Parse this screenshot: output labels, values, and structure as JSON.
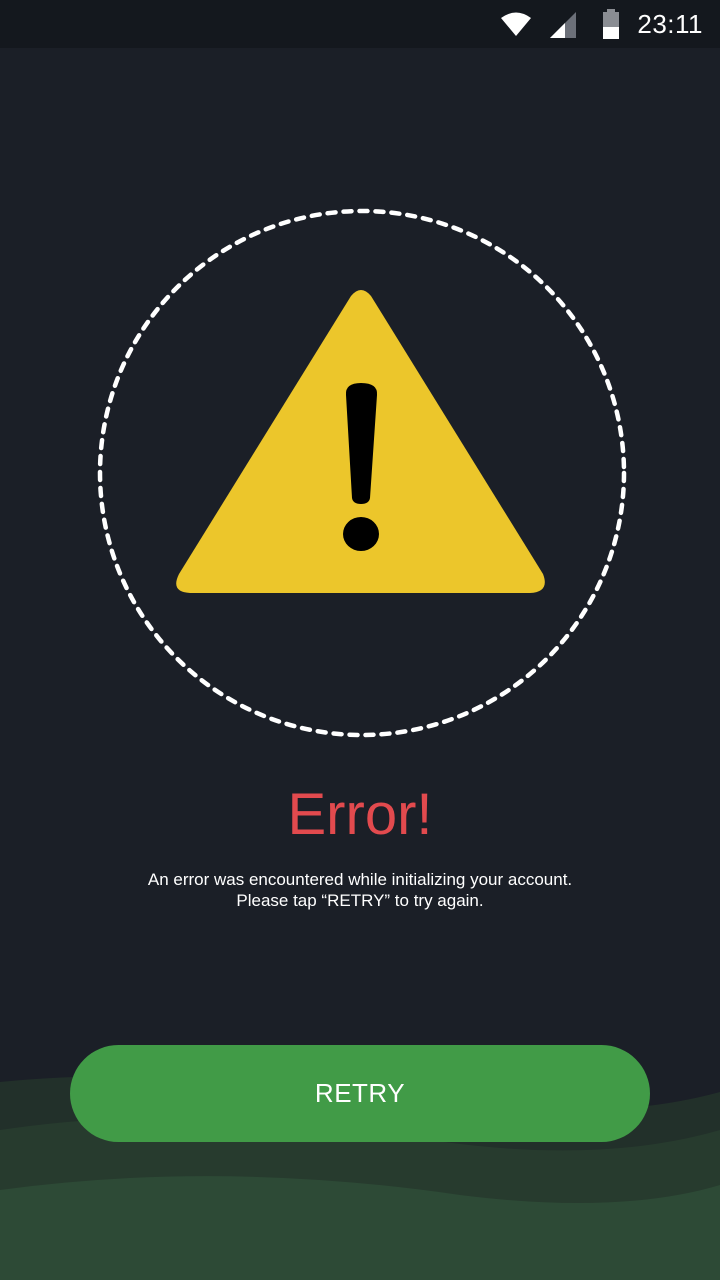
{
  "status_bar": {
    "time": "23:11",
    "icons": [
      "wifi-icon",
      "signal-icon",
      "battery-icon"
    ]
  },
  "error": {
    "icon": "warning-icon",
    "title": "Error!",
    "message_line_1": "An error was encountered while initializing your account.",
    "message_line_2": "Please tap “RETRY” to try again."
  },
  "actions": {
    "retry_label": "RETRY"
  },
  "colors": {
    "background": "#1b1f27",
    "status_bar": "#14181e",
    "warning_yellow": "#ecc62b",
    "error_red": "#e24a4e",
    "button_green": "#419b47",
    "bottom_hills": "#2d4a36"
  }
}
